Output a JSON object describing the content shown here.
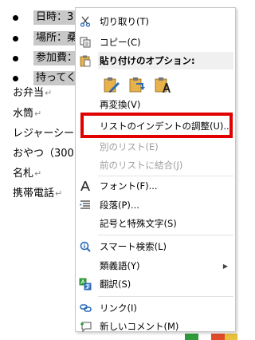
{
  "document": {
    "bullets": [
      "日時：3",
      "場所：桑",
      "参加費：",
      "持ってく"
    ],
    "lines": [
      "お弁当",
      "水筒",
      "レジャーシー",
      "おやつ（300",
      "名札",
      "携帯電話"
    ],
    "para_mark": "↵"
  },
  "menu": {
    "cut": "切り取り(T)",
    "copy": "コピー(C)",
    "paste_options": "貼り付けのオプション:",
    "reconvert": "再変換(V)",
    "list_indent": "リストのインデントの調整(U)...",
    "separate_list": "別のリスト(E)",
    "join_prev_list": "前のリストに結合(J)",
    "font": "フォント(F)...",
    "paragraph": "段落(P)...",
    "symbols": "記号と特殊文字(S)",
    "smart_lookup": "スマート検索(L)",
    "synonyms": "類義語(Y)",
    "translate": "翻訳(S)",
    "link": "リンク(I)",
    "new_comment": "新しいコメント(M)"
  },
  "colors": {
    "highlight_border": "#e00000",
    "selection_bg": "#c8c8c8",
    "disabled_text": "#9d9d9d",
    "icon_blue": "#2b6cb8"
  }
}
